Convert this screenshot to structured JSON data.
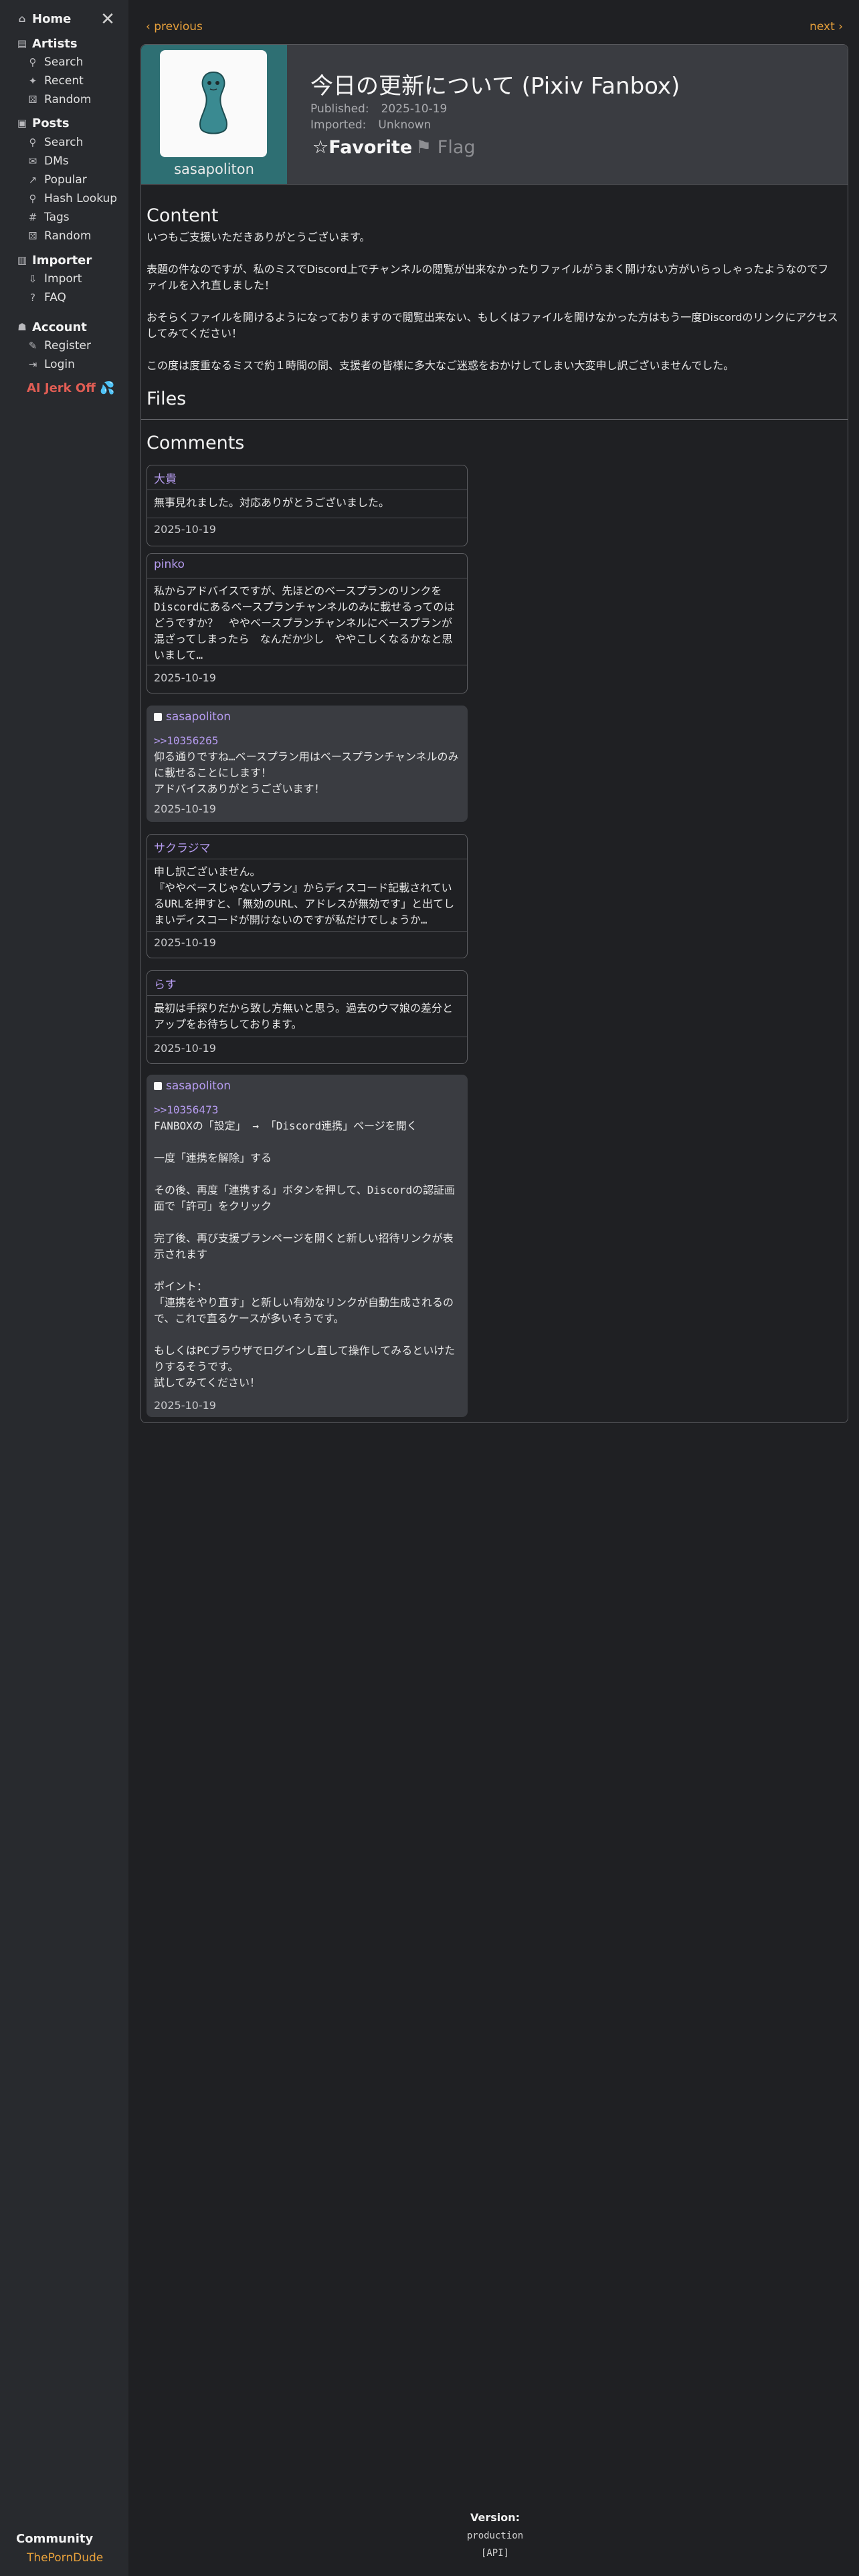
{
  "sidebar": {
    "home": "Home",
    "artists": {
      "title": "Artists",
      "items": [
        "Search",
        "Recent",
        "Random"
      ]
    },
    "posts": {
      "title": "Posts",
      "items": [
        "Search",
        "DMs",
        "Popular",
        "Hash Lookup",
        "Tags",
        "Random"
      ]
    },
    "importer": {
      "title": "Importer",
      "items": [
        "Import",
        "FAQ"
      ]
    },
    "account": {
      "title": "Account",
      "items": [
        "Register",
        "Login"
      ]
    },
    "promo": "AI Jerk Off 💦",
    "community": "Community",
    "community_link": "ThePornDude"
  },
  "pager": {
    "prev": "‹ previous",
    "next": "next ›"
  },
  "post": {
    "artist": "sasapoliton",
    "title": "今日の更新について (Pixiv Fanbox)",
    "published_label": "Published:",
    "published": "2025-10-19",
    "imported_label": "Imported:",
    "imported": "Unknown",
    "favorite": "☆Favorite",
    "flag": "⚑ Flag",
    "content_title": "Content",
    "content": [
      "いつもご支援いただきありがとうございます。",
      "表題の件なのですが、私のミスでDiscord上でチャンネルの閲覧が出来なかったりファイルがうまく開けない方がいらっしゃったようなのでファイルを入れ直しました！",
      "おそらくファイルを開けるようになっておりますので閲覧出来ない、もしくはファイルを開けなかった方はもう一度Discordのリンクにアクセスしてみてください！",
      "この度は度重なるミスで約１時間の間、支援者の皆様に多大なご迷惑をおかけしてしまい大変申し訳ございませんでした。"
    ],
    "files_title": "Files",
    "comments_title": "Comments"
  },
  "comments": [
    {
      "author": "大貴",
      "reply": "",
      "body": "無事見れました。対応ありがとうございました。",
      "date": "2025-10-19"
    },
    {
      "author": "pinko",
      "reply": "",
      "body": "私からアドバイスですが、先ほどのベースプランのリンクをDiscordにあるベースプランチャンネルのみに載せるってのはどうですか？　ややベースプランチャンネルにベースプランが混ざってしまったら　なんだか少し　ややこしくなるかなと思いまして…",
      "date": "2025-10-19"
    },
    {
      "author": "sasapoliton",
      "reply": ">>10356265",
      "body": "仰る通りですね…ベースプラン用はベースプランチャンネルのみに載せることにします！\nアドバイスありがとうございます！",
      "date": "2025-10-19"
    },
    {
      "author": "サクラジマ",
      "reply": "",
      "body": "申し訳ございません。\n『ややベースじゃないプラン』からディスコード記載されているURLを押すと、「無効のURL、アドレスが無効です」と出てしまいディスコードが開けないのですが私だけでしょうか…",
      "date": "2025-10-19"
    },
    {
      "author": "らす",
      "reply": "",
      "body": "最初は手探りだから致し方無いと思う。過去のウマ娘の差分とアップをお待ちしております。",
      "date": "2025-10-19"
    },
    {
      "author": "sasapoliton",
      "reply": ">>10356473",
      "body": "FANBOXの「設定」 → 「Discord連携」ページを開く\n\n一度「連携を解除」する\n\nその後、再度「連携する」ボタンを押して、Discordの認証画面で「許可」をクリック\n\n完了後、再び支援プランページを開くと新しい招待リンクが表示されます\n\nポイント：\n「連携をやり直す」と新しい有効なリンクが自動生成されるので、これで直るケースが多いそうです。\n\nもしくはPCブラウザでログインし直して操作してみるといけたりするそうです。\n試してみてください！",
      "date": "2025-10-19"
    }
  ],
  "footer": {
    "version_label": "Version:",
    "version": "production",
    "api": "[API]"
  }
}
